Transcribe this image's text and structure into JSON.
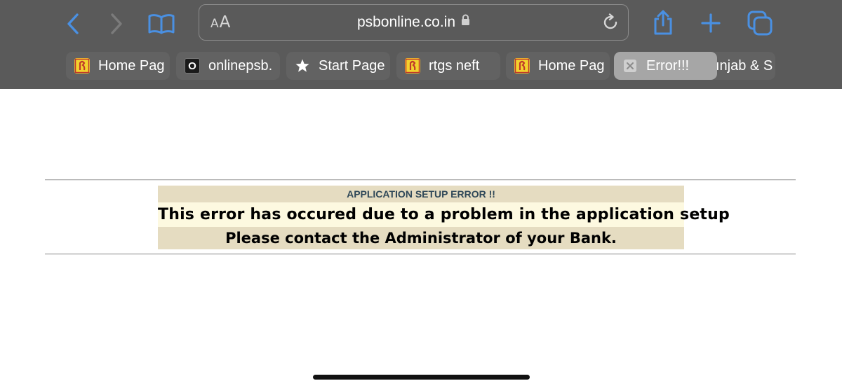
{
  "browser": {
    "address_bar": {
      "reader_small": "A",
      "reader_big": "A",
      "url": "psbonline.co.in"
    },
    "toolbar_icons": [
      "back-icon",
      "forward-icon",
      "bookmarks-icon",
      "lock-icon",
      "reload-icon",
      "share-icon",
      "new-tab-icon",
      "tabs-overview-icon"
    ],
    "tabs": [
      {
        "label": "Home Pag",
        "favicon": "bank-logo-icon"
      },
      {
        "label": "onlinepsb.",
        "favicon": "o-icon",
        "favicon_text": "O"
      },
      {
        "label": "Start Page",
        "favicon": "star-icon"
      },
      {
        "label": "rtgs neft",
        "favicon": "bank-logo-icon"
      },
      {
        "label": "Home Pag",
        "favicon": "bank-logo-icon"
      },
      {
        "label": "Error!!!",
        "favicon": "close-icon",
        "active": true
      },
      {
        "label": "ınjab & S",
        "favicon": "none"
      }
    ],
    "colors": {
      "accent": "#4a90e2",
      "chrome": "#5a5a5a"
    }
  },
  "page": {
    "error_title": "APPLICATION SETUP ERROR !!",
    "error_message": "This error has occured due to a problem in the application setup",
    "error_contact": "Please contact the Administrator of your Bank."
  }
}
